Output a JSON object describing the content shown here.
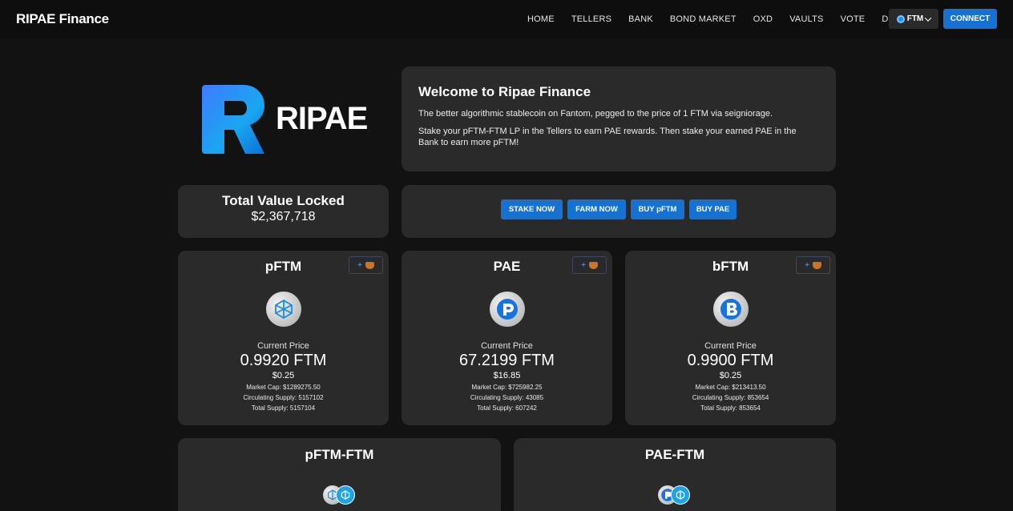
{
  "nav": {
    "brand": "RIPAE Finance",
    "links": [
      "HOME",
      "TELLERS",
      "BANK",
      "BOND MARKET",
      "OXD",
      "VAULTS",
      "VOTE",
      "DOCS"
    ],
    "network": "FTM",
    "connect": "CONNECT"
  },
  "hero": {
    "logo_text": "RIPAE",
    "title": "Welcome to Ripae Finance",
    "p1": "The better algorithmic stablecoin on Fantom, pegged to the price of 1 FTM via seigniorage.",
    "p2": "Stake your pFTM-FTM LP in the Tellers to earn PAE rewards. Then stake your earned PAE in the Bank to earn more pFTM!"
  },
  "tvl": {
    "title": "Total Value Locked",
    "value": "$2,367,718"
  },
  "actions": [
    "STAKE NOW",
    "FARM NOW",
    "BUY pFTM",
    "BUY PAE"
  ],
  "tokens": [
    {
      "name": "pFTM",
      "add": "+",
      "price_label": "Current Price",
      "price_ftm": "0.9920 FTM",
      "price_usd": "$0.25",
      "market_cap": "Market Cap: $1289275.50",
      "circ_supply": "Circulating Supply: 5157102",
      "total_supply": "Total Supply: 5157104"
    },
    {
      "name": "PAE",
      "add": "+",
      "price_label": "Current Price",
      "price_ftm": "67.2199 FTM",
      "price_usd": "$16.85",
      "market_cap": "Market Cap: $725982.25",
      "circ_supply": "Circulating Supply: 43085",
      "total_supply": "Total Supply: 607242"
    },
    {
      "name": "bFTM",
      "add": "+",
      "price_label": "Current Price",
      "price_ftm": "0.9900 FTM",
      "price_usd": "$0.25",
      "market_cap": "Market Cap: $213413.50",
      "circ_supply": "Circulating Supply: 853654",
      "total_supply": "Total Supply: 853654"
    }
  ],
  "lps": [
    {
      "name": "pFTM-FTM"
    },
    {
      "name": "PAE-FTM"
    }
  ],
  "colors": {
    "background": "#121212",
    "card": "#2a2a2b",
    "accent": "#1771d1",
    "navbar": "#0e0e0e"
  },
  "icons": {
    "network": "fantom-icon",
    "metamask": "metamask-fox-icon",
    "pftm": "pftm-token-icon",
    "pae": "pae-token-icon",
    "bftm": "bftm-token-icon"
  }
}
